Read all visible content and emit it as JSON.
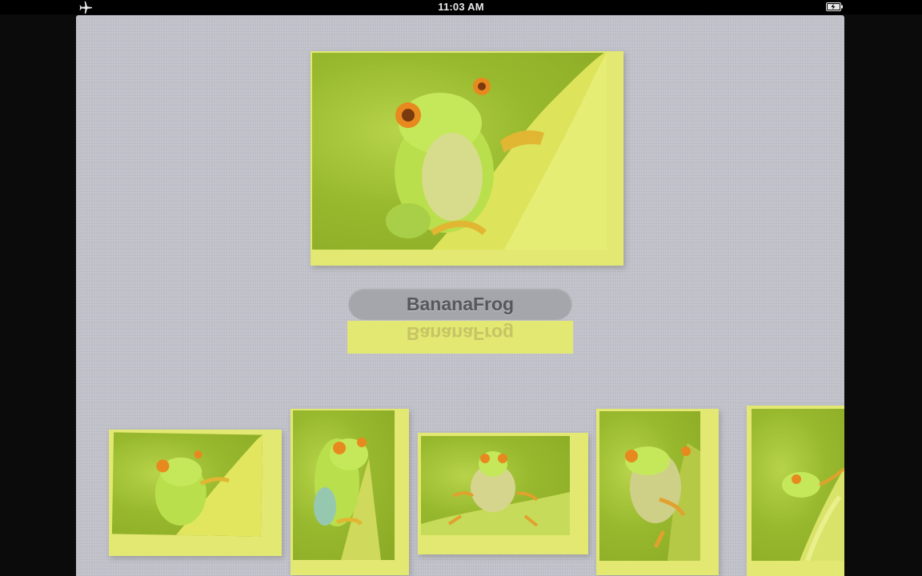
{
  "status_bar": {
    "time": "11:03 AM",
    "left_icon": "airplane-icon",
    "right_icon": "battery-icon"
  },
  "album": {
    "title": "BananaFrog",
    "featured_photo": {
      "subject": "red-eyed tree frog on banana leaf"
    },
    "thumbnail_count": 5
  },
  "colors": {
    "panel_background": "#bfc0c8",
    "photo_tint": "#e3e872",
    "pill_background": "#a5a6ab",
    "pill_text": "#55575d",
    "status_bar": "#000000"
  }
}
